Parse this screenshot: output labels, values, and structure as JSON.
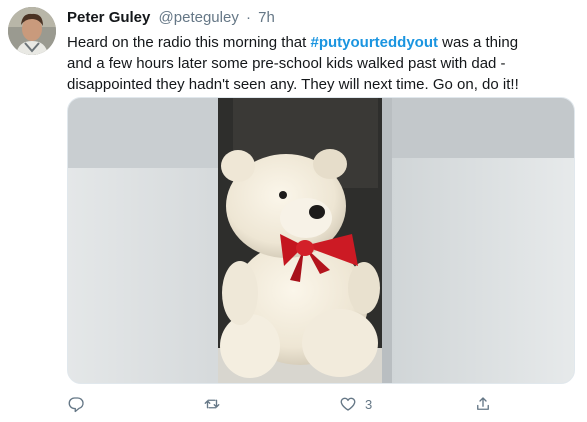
{
  "tweet": {
    "author_name": "Peter Guley",
    "handle": "@peteguley",
    "separator": "·",
    "time": "7h",
    "text_line1_before": "Heard on the radio this morning that ",
    "hashtag": "#putyourteddyout",
    "text_line1_after": " was a thing",
    "text_line2": "and a few hours later some pre-school kids walked past with dad -",
    "text_line3": "disappointed they hadn't seen any. They will next time. Go on, do it!!"
  },
  "actions": {
    "reply_icon": "reply-icon",
    "retweet_icon": "retweet-icon",
    "like_icon": "heart-icon",
    "like_count": "3",
    "share_icon": "share-icon"
  },
  "colors": {
    "hashtag": "#1b95e0",
    "muted": "#657786"
  }
}
